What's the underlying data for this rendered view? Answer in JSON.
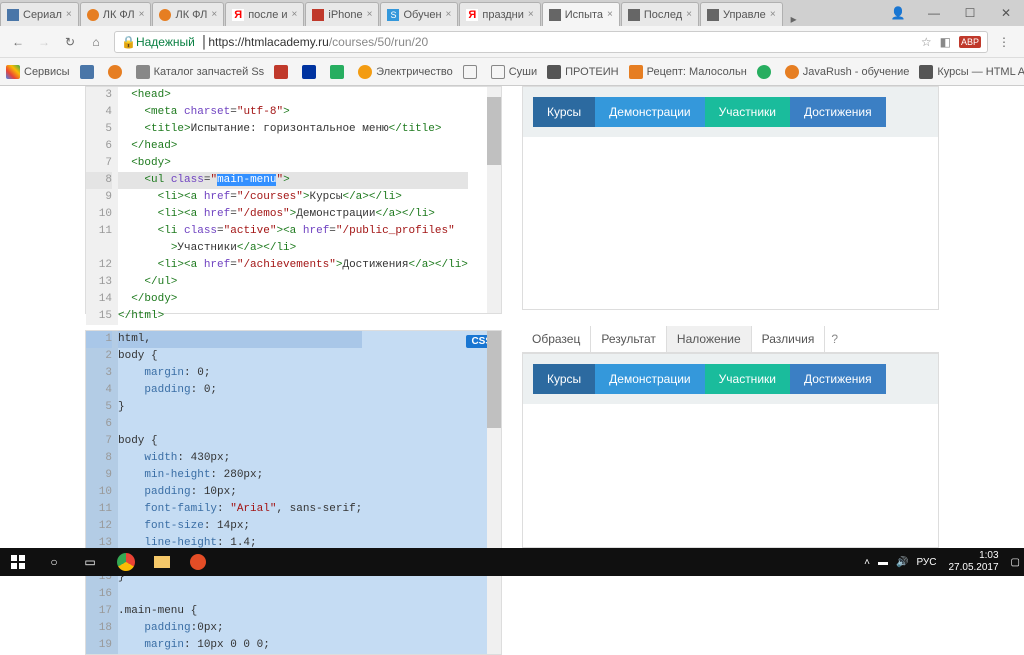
{
  "tabs": [
    {
      "label": "Сериал",
      "icon": "#4a76a8"
    },
    {
      "label": "ЛК ФЛ",
      "icon": "#e67e22"
    },
    {
      "label": "ЛК ФЛ",
      "icon": "#e67e22"
    },
    {
      "label": "после и",
      "icon": "#ff0000"
    },
    {
      "label": "iPhone",
      "icon": "#c0392b"
    },
    {
      "label": "Обучен",
      "icon": "#3498db"
    },
    {
      "label": "праздни",
      "icon": "#ff0000"
    },
    {
      "label": "Испыта",
      "icon": "#666",
      "active": true
    },
    {
      "label": "Послед",
      "icon": "#666"
    },
    {
      "label": "Управле",
      "icon": "#666"
    }
  ],
  "address": {
    "secure_label": "Надежный",
    "host": "https://htmlacademy.ru",
    "path": "/courses/50/run/20"
  },
  "bookmarks": {
    "apps": "Сервисы",
    "items": [
      {
        "label": "",
        "color": "#4a76a8"
      },
      {
        "label": "",
        "color": "#e67e22"
      },
      {
        "label": "Каталог запчастей Ss",
        "color": "#888"
      },
      {
        "label": "",
        "color": "#c0392b"
      },
      {
        "label": "",
        "color": "#0033a0"
      },
      {
        "label": "",
        "color": "#27ae60"
      },
      {
        "label": "Электричество",
        "color": "#f39c12"
      },
      {
        "label": "",
        "color": "#555"
      },
      {
        "label": "Суши",
        "color": "#555"
      },
      {
        "label": "ПРОТЕИН",
        "color": "#555"
      },
      {
        "label": "Рецепт: Малосольн",
        "color": "#e67e22"
      },
      {
        "label": "",
        "color": "#27ae60"
      },
      {
        "label": "JavaRush - обучение",
        "color": "#e67e22"
      },
      {
        "label": "Курсы — HTML Acad",
        "color": "#555"
      }
    ]
  },
  "html_editor": {
    "lines": [
      "3",
      "4",
      "5",
      "6",
      "7",
      "8",
      "9",
      "10",
      "11",
      "12",
      "13",
      "14",
      "15"
    ],
    "start": 3
  },
  "css_editor": {
    "badge": "CSS"
  },
  "preview_menu": {
    "courses": "Курсы",
    "demos": "Демонстрации",
    "users": "Участники",
    "achieve": "Достижения"
  },
  "result_tabs": {
    "sample": "Образец",
    "result": "Результат",
    "overlay": "Наложение",
    "diff": "Различия",
    "help": "?"
  },
  "taskbar": {
    "lang": "РУС",
    "time": "1:03",
    "date": "27.05.2017"
  }
}
